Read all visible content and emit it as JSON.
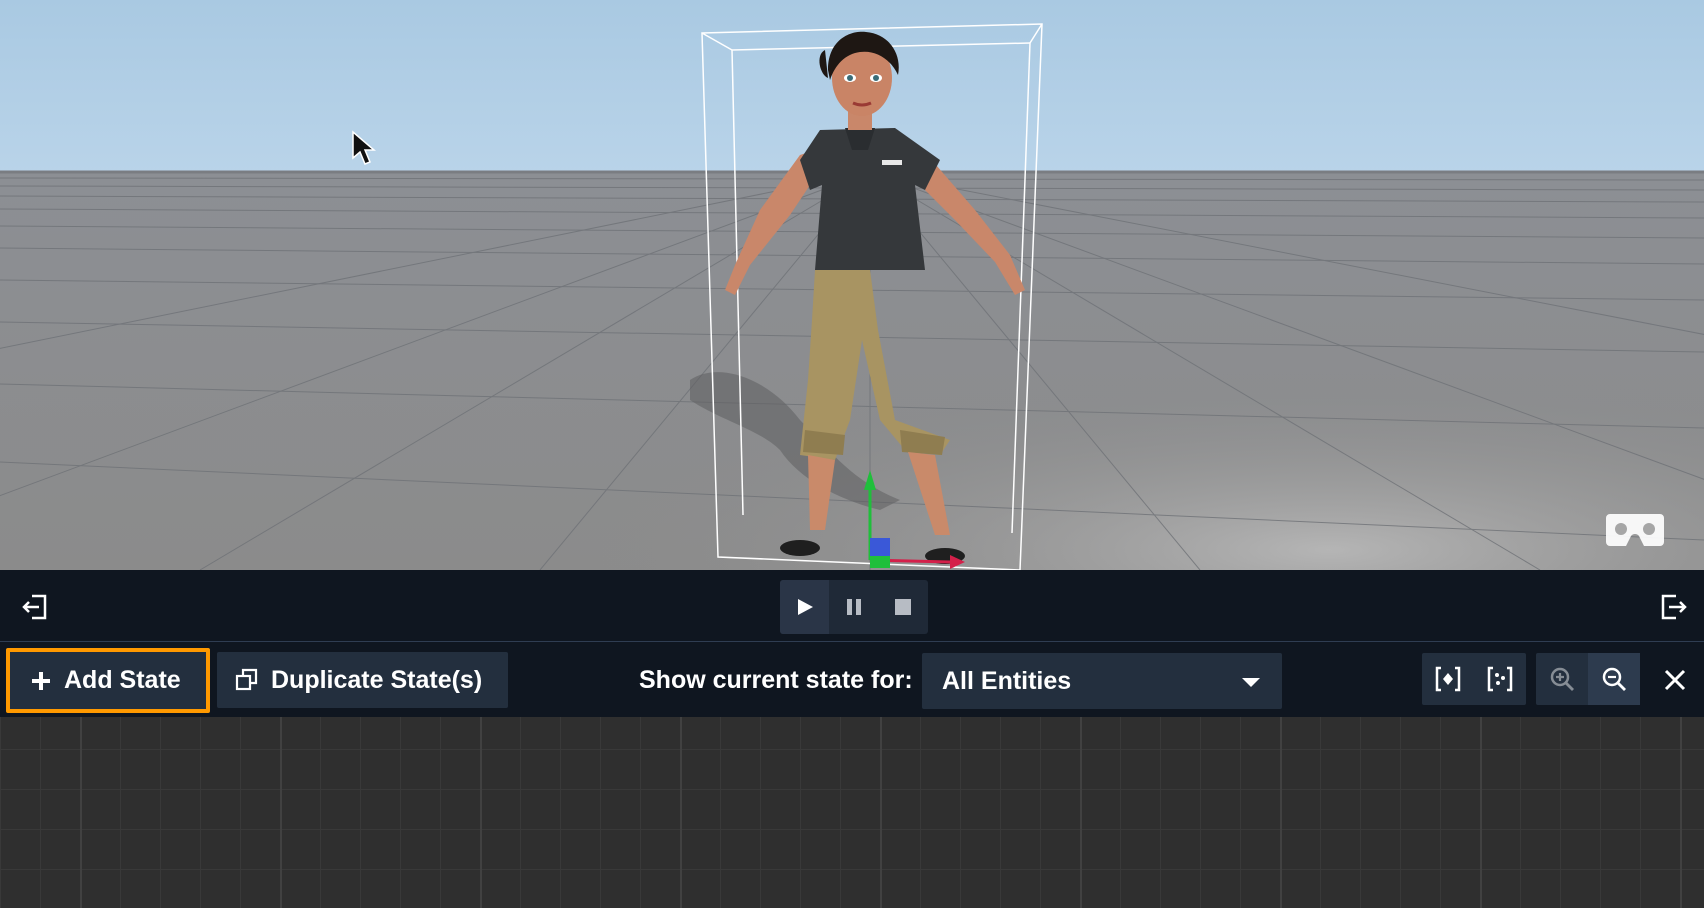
{
  "viewport": {
    "vr_icon": "vr-headset-icon",
    "cursor_icon": "mouse-pointer-icon"
  },
  "playback": {
    "collapse_left_icon": "panel-collapse-left-icon",
    "expand_right_icon": "panel-expand-right-icon",
    "controls": [
      {
        "name": "play",
        "icon": "play-icon"
      },
      {
        "name": "pause",
        "icon": "pause-icon"
      },
      {
        "name": "stop",
        "icon": "stop-icon"
      }
    ]
  },
  "toolbar": {
    "add_state_label": "Add State",
    "duplicate_state_label": "Duplicate State(s)",
    "show_current_label": "Show current state for:",
    "entity_select_value": "All Entities",
    "highlight_color": "#ff9900",
    "icons": [
      "fit-selection-icon",
      "fit-all-icon",
      "zoom-in-icon",
      "zoom-out-icon",
      "close-icon"
    ]
  },
  "colors": {
    "panel_bg": "#0f1620",
    "button_bg": "#232f3e",
    "accent": "#ff9900"
  }
}
